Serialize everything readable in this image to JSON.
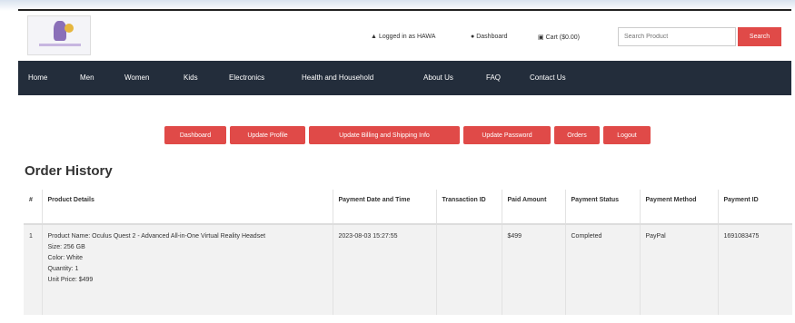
{
  "header": {
    "logged_in": "Logged in as HAWA",
    "dashboard": "Dashboard",
    "cart": "Cart ($0.00)"
  },
  "search": {
    "placeholder": "Search Product",
    "button": "Search"
  },
  "nav": [
    "Home",
    "Men",
    "Women",
    "Kids",
    "Electronics",
    "Health and Household",
    "About Us",
    "FAQ",
    "Contact Us"
  ],
  "account_tabs": [
    "Dashboard",
    "Update Profile",
    "Update Billing and Shipping Info",
    "Update Password",
    "Orders",
    "Logout"
  ],
  "page_title": "Order History",
  "table": {
    "headers": [
      "#",
      "Product Details",
      "Payment Date and Time",
      "Transaction ID",
      "Paid Amount",
      "Payment Status",
      "Payment Method",
      "Payment ID"
    ],
    "rows": [
      {
        "num": "1",
        "product_lines": [
          "Product Name: Oculus Quest 2 - Advanced All-in-One Virtual Reality Headset",
          "Size: 256 GB",
          "Color: White",
          "Quantity: 1",
          "Unit Price: $499"
        ],
        "date": "2023-08-03 15:27:55",
        "transaction_id": "",
        "amount": "$499",
        "status": "Completed",
        "method": "PayPal",
        "payment_id": "1691083475"
      }
    ]
  },
  "icons": {
    "user": "user-icon",
    "dashboard": "dashboard-icon",
    "cart": "cart-icon",
    "logo": "store-logo"
  },
  "colors": {
    "accent": "#e04a48",
    "navbar": "#232d3b"
  }
}
